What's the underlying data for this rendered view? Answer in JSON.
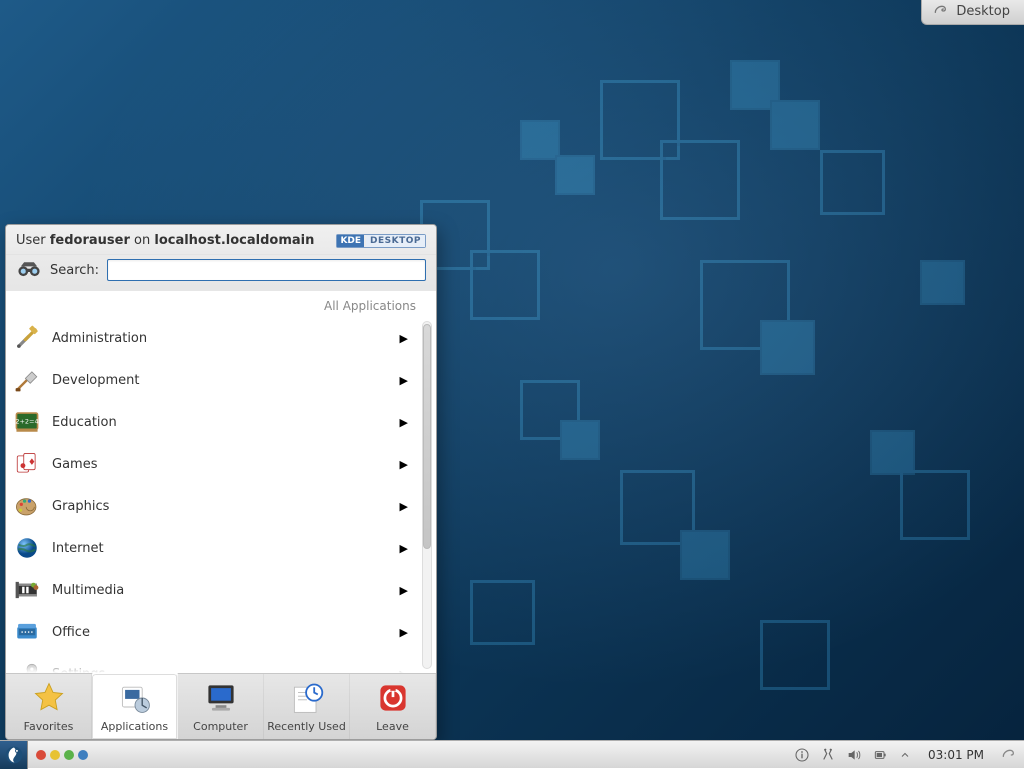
{
  "toolbox": {
    "label": "Desktop"
  },
  "kickoff": {
    "user_prefix": "User ",
    "username": "fedorauser",
    "on_word": " on ",
    "host": "localhost.localdomain",
    "badge_left": "KDE",
    "badge_right": "DESKTOP",
    "search_label": "Search:",
    "search_value": "",
    "crumb": "All Applications",
    "categories": [
      {
        "label": "Administration",
        "icon": "admin"
      },
      {
        "label": "Development",
        "icon": "dev"
      },
      {
        "label": "Education",
        "icon": "edu"
      },
      {
        "label": "Games",
        "icon": "games"
      },
      {
        "label": "Graphics",
        "icon": "graphics"
      },
      {
        "label": "Internet",
        "icon": "internet"
      },
      {
        "label": "Multimedia",
        "icon": "multimedia"
      },
      {
        "label": "Office",
        "icon": "office"
      },
      {
        "label": "Settings",
        "icon": "settings"
      }
    ],
    "tabs": [
      {
        "label": "Favorites",
        "icon": "star"
      },
      {
        "label": "Applications",
        "icon": "apps",
        "active": true
      },
      {
        "label": "Computer",
        "icon": "computer"
      },
      {
        "label": "Recently Used",
        "icon": "recent"
      },
      {
        "label": "Leave",
        "icon": "leave"
      }
    ]
  },
  "taskbar": {
    "workspaces": [
      "red",
      "yellow",
      "green",
      "blue"
    ],
    "clock": "03:01 PM",
    "tray_icons": [
      "info",
      "clipboard",
      "sound",
      "battery",
      "updates"
    ]
  }
}
